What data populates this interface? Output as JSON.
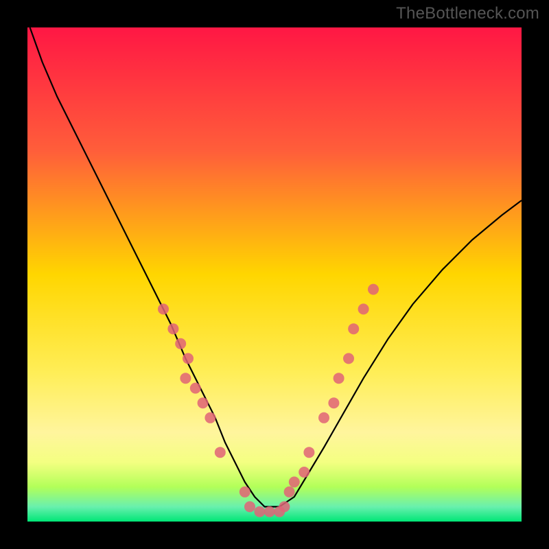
{
  "watermark": "TheBottleneck.com",
  "chart_data": {
    "type": "line",
    "title": "",
    "xlabel": "",
    "ylabel": "",
    "xlim": [
      0,
      100
    ],
    "ylim": [
      0,
      100
    ],
    "grid": false,
    "series": [
      {
        "name": "curve",
        "color": "#000000",
        "x": [
          0.5,
          3,
          6,
          10,
          14,
          18,
          22,
          26,
          29,
          32,
          35,
          38,
          40,
          42,
          44,
          46,
          48,
          51,
          54,
          57,
          60,
          64,
          68,
          73,
          78,
          84,
          90,
          96,
          100
        ],
        "y": [
          100,
          93,
          86,
          78,
          70,
          62,
          54,
          46,
          40,
          33,
          27,
          21,
          16,
          12,
          8,
          5,
          3,
          3,
          5,
          10,
          15,
          22,
          29,
          37,
          44,
          51,
          57,
          62,
          65
        ]
      }
    ],
    "markers": [
      {
        "x": 27.5,
        "y": 43
      },
      {
        "x": 29.5,
        "y": 39
      },
      {
        "x": 31,
        "y": 36
      },
      {
        "x": 32.5,
        "y": 33
      },
      {
        "x": 32,
        "y": 29
      },
      {
        "x": 34,
        "y": 27
      },
      {
        "x": 35.5,
        "y": 24
      },
      {
        "x": 37,
        "y": 21
      },
      {
        "x": 39,
        "y": 14
      },
      {
        "x": 44,
        "y": 6
      },
      {
        "x": 45,
        "y": 3
      },
      {
        "x": 47,
        "y": 2
      },
      {
        "x": 49,
        "y": 2
      },
      {
        "x": 51,
        "y": 2
      },
      {
        "x": 52,
        "y": 3
      },
      {
        "x": 53,
        "y": 6
      },
      {
        "x": 54,
        "y": 8
      },
      {
        "x": 56,
        "y": 10
      },
      {
        "x": 57,
        "y": 14
      },
      {
        "x": 60,
        "y": 21
      },
      {
        "x": 62,
        "y": 24
      },
      {
        "x": 63,
        "y": 29
      },
      {
        "x": 65,
        "y": 33
      },
      {
        "x": 66,
        "y": 39
      },
      {
        "x": 68,
        "y": 43
      },
      {
        "x": 70,
        "y": 47
      }
    ],
    "marker_color": "#e06377",
    "gradient_stops": [
      {
        "offset": 0,
        "color": "#ff1744"
      },
      {
        "offset": 0.25,
        "color": "#ff5e3a"
      },
      {
        "offset": 0.5,
        "color": "#ffd600"
      },
      {
        "offset": 0.7,
        "color": "#ffee58"
      },
      {
        "offset": 0.82,
        "color": "#fff59d"
      },
      {
        "offset": 0.88,
        "color": "#f4ff81"
      },
      {
        "offset": 0.93,
        "color": "#b2ff59"
      },
      {
        "offset": 0.97,
        "color": "#69f0ae"
      },
      {
        "offset": 1.0,
        "color": "#00e676"
      }
    ]
  }
}
